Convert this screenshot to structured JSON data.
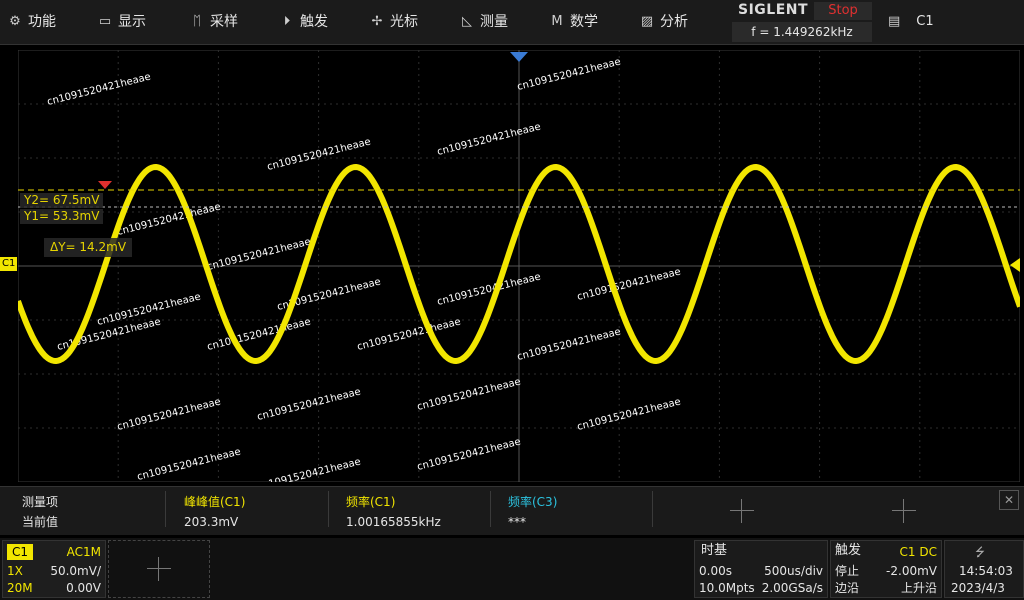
{
  "menu": {
    "items": [
      {
        "label": "功能",
        "icon": "gear-icon",
        "glyph": "⚙"
      },
      {
        "label": "显示",
        "icon": "monitor-icon",
        "glyph": "▭"
      },
      {
        "label": "采样",
        "icon": "sampling-icon",
        "glyph": "ᛖ"
      },
      {
        "label": "触发",
        "icon": "trigger-icon",
        "glyph": "⏵"
      },
      {
        "label": "光标",
        "icon": "cursor-icon",
        "glyph": "✢"
      },
      {
        "label": "测量",
        "icon": "measure-icon",
        "glyph": "◺"
      },
      {
        "label": "数学",
        "icon": "math-icon",
        "glyph": "M"
      },
      {
        "label": "分析",
        "icon": "analysis-icon",
        "glyph": "▨"
      }
    ]
  },
  "brand": {
    "logo": "SIGLENT",
    "status": "Stop",
    "freq": "f = 1.449262kHz"
  },
  "top_channel": {
    "label": "C1",
    "icon": "document-icon"
  },
  "watermark": "cn1091520421heaae",
  "cursors": {
    "y2_label": "Y2= 67.5mV",
    "y1_label": "Y1= 53.3mV",
    "dy_label": "ΔY= 14.2mV",
    "channel_marker": "C1"
  },
  "measure": {
    "header_item": "测量项",
    "header_current": "当前值",
    "cols": [
      {
        "name": "峰峰值(C1)",
        "value": "203.3mV",
        "color": "#f2e600"
      },
      {
        "name": "频率(C1)",
        "value": "1.00165855kHz",
        "color": "#f2e600"
      },
      {
        "name": "频率(C3)",
        "value": "***",
        "color": "#2cc3e0"
      }
    ]
  },
  "channel": {
    "name": "C1",
    "coupling": "AC1M",
    "probe": "1X",
    "scale": "50.0mV/",
    "bw": "20M",
    "offset": "0.00V"
  },
  "timebase": {
    "title": "时基",
    "delay": "0.00s",
    "scale": "500us/div",
    "mem": "10.0Mpts",
    "rate": "2.00GSa/s"
  },
  "trigger": {
    "title": "触发",
    "source": "C1 DC",
    "mode": "停止",
    "level": "-2.00mV",
    "type": "边沿",
    "slope": "上升沿"
  },
  "clock": {
    "time": "14:54:03",
    "date": "2023/4/3",
    "icon": "usb-icon"
  },
  "colors": {
    "ch1": "#f2e600",
    "accent_red": "#e03030",
    "trigger_blue": "#3a7bd5"
  }
}
